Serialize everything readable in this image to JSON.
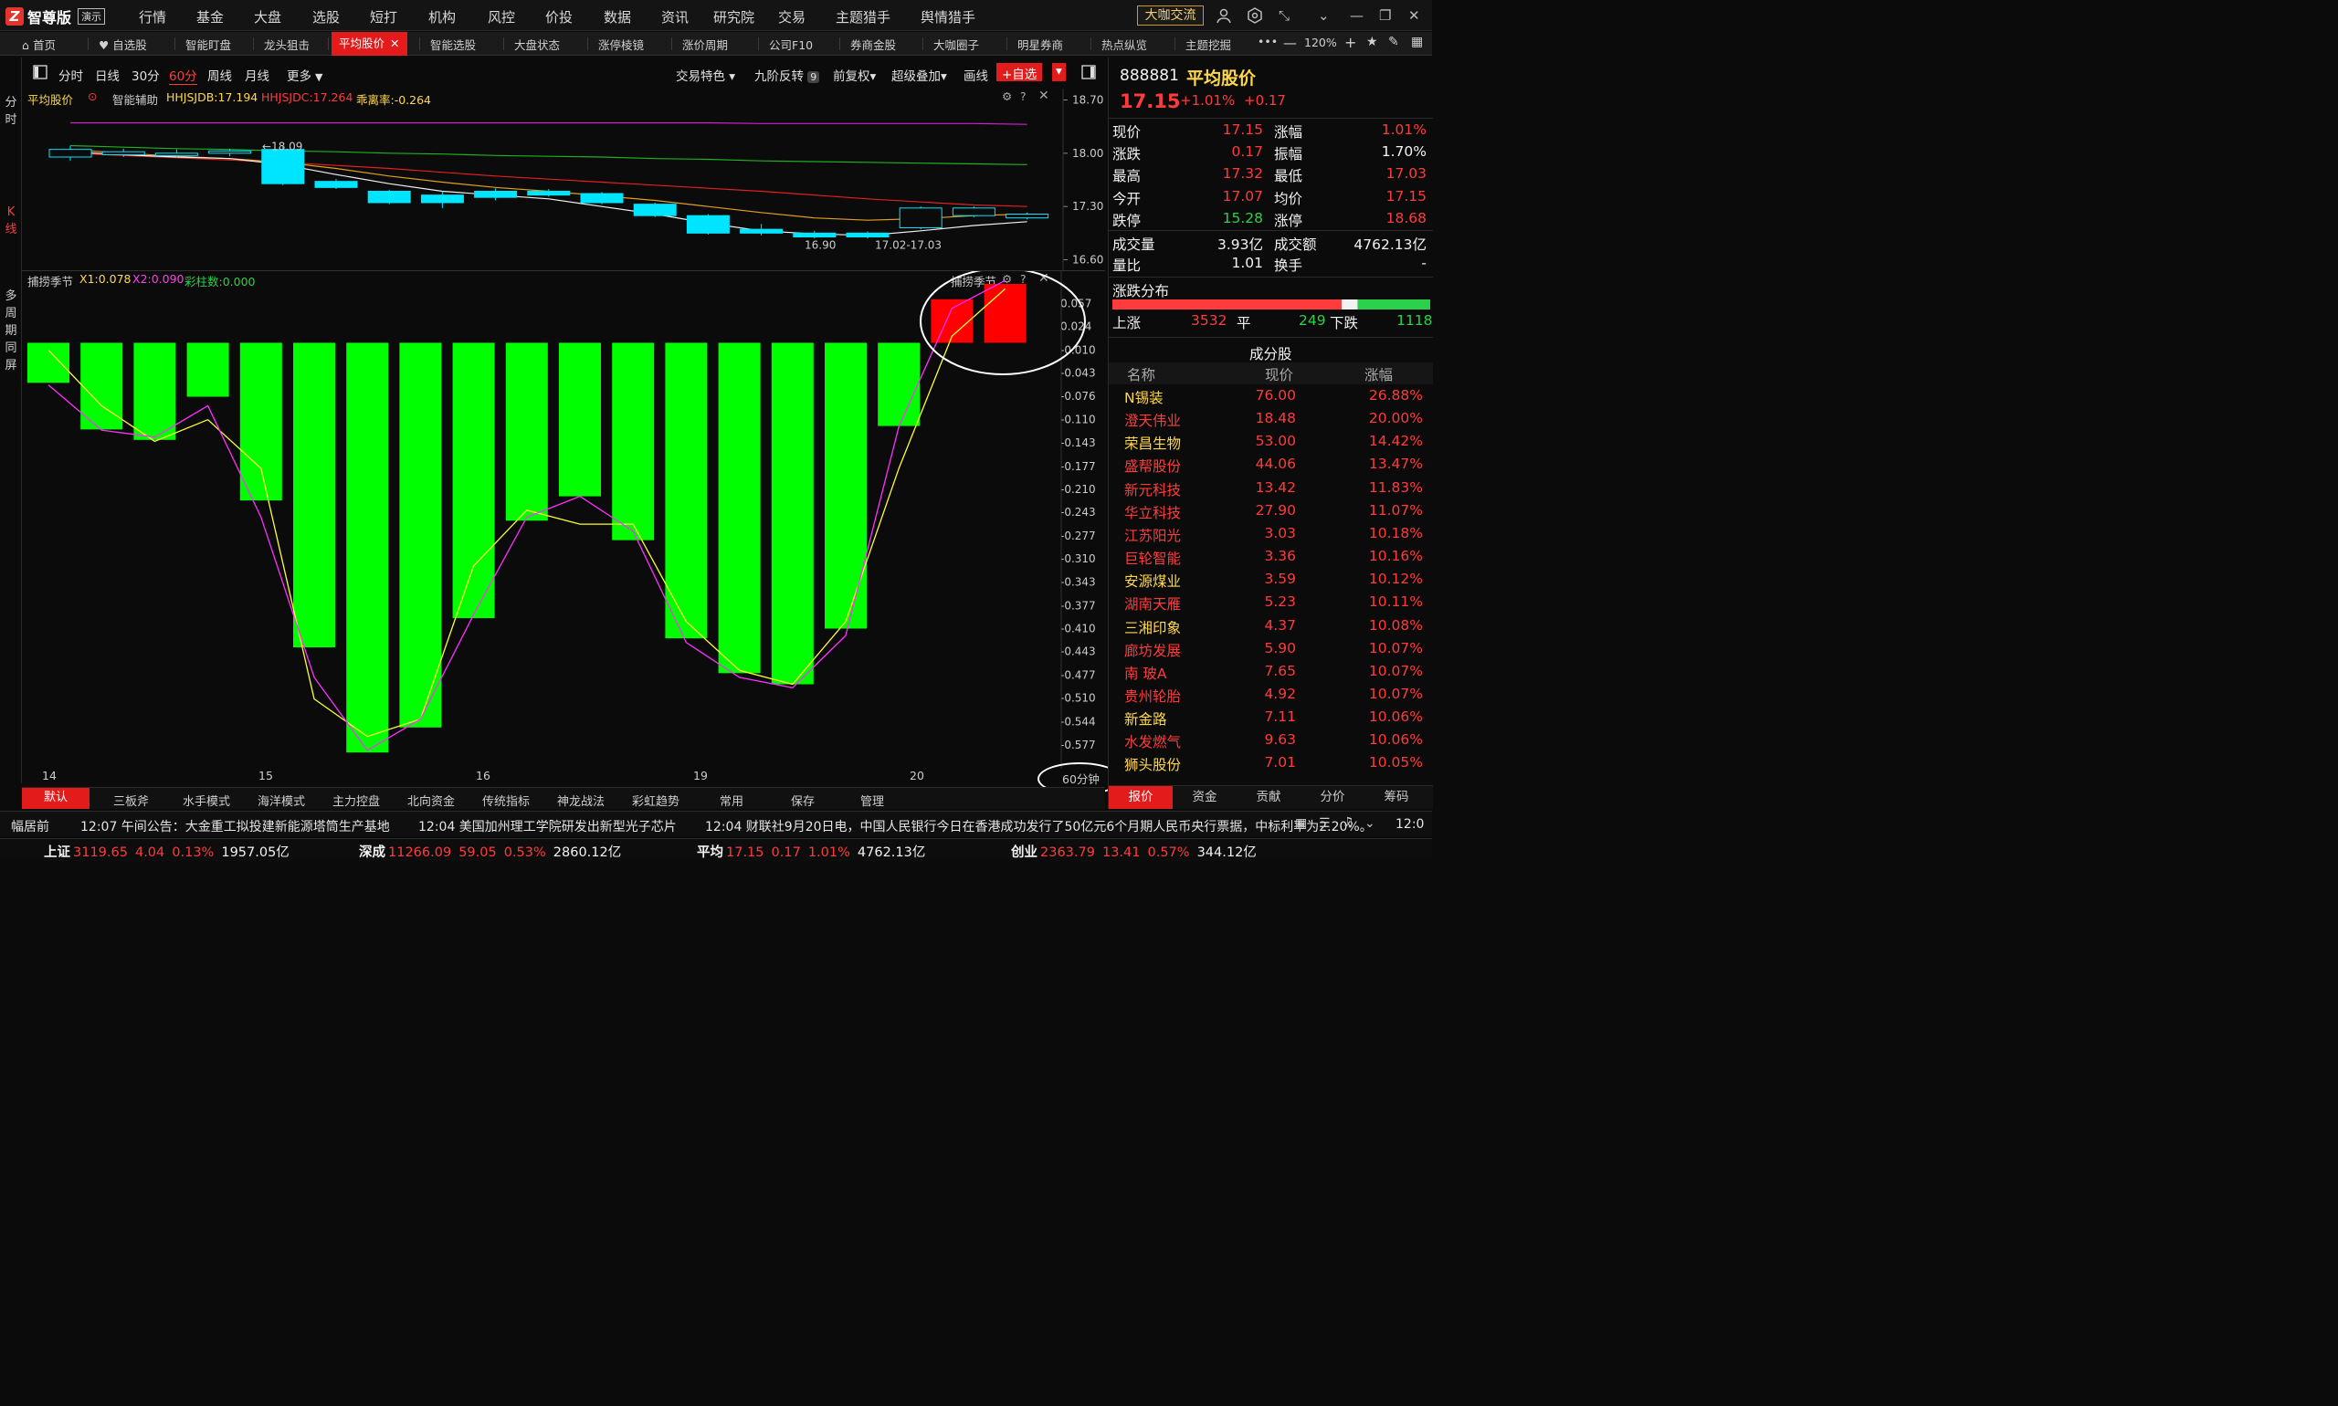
{
  "app": {
    "logo_text": "智尊版",
    "demo_badge": "演示"
  },
  "top_menu": [
    "行情",
    "基金",
    "大盘",
    "选股",
    "短打",
    "机构",
    "风控",
    "价投",
    "数据",
    "资讯",
    "研究院",
    "交易",
    "主题猎手",
    "舆情猎手"
  ],
  "daka_button": "大咖交流",
  "tabs": [
    "首页",
    "自选股",
    "智能盯盘",
    "龙头狙击",
    "平均股价",
    "智能选股",
    "大盘状态",
    "涨停棱镜",
    "涨价周期",
    "公司F10",
    "券商金股",
    "大咖圈子",
    "明星券商",
    "热点纵览",
    "主题挖掘"
  ],
  "active_tab_index": 4,
  "zoom_level": "120%",
  "left_strip": {
    "minute": "分时",
    "kline": "K线",
    "multi": "多周期同屏"
  },
  "period_buttons": [
    "分时",
    "日线",
    "30分",
    "60分",
    "周线",
    "月线",
    "更多"
  ],
  "active_period_index": 3,
  "chart_toolbar": {
    "trade_feature": "交易特色",
    "nine_reversal": "九阶反转",
    "nine_badge": "9",
    "adjust": "前复权",
    "overlay": "超级叠加",
    "draw": "画线",
    "add_watch": "+自选"
  },
  "kline_panel": {
    "indicator_name": "平均股价",
    "assist": "智能辅助",
    "hhjsjdb": "HHJSJDB:17.194",
    "hhjsjdc": "HHJSJDC:17.264",
    "deviation": "乖离率:-0.264",
    "y_ticks": [
      "18.70",
      "18.00",
      "17.30",
      "16.60"
    ],
    "high_marker": "←18.09",
    "low_marker": "16.90",
    "range_marker": "17.02-17.03"
  },
  "low_panel": {
    "indicator_name": "捕捞季节",
    "x1": "X1:0.078",
    "x2": "X2:0.090",
    "bars_count": "彩柱数:0.000",
    "corner_label": "捕捞季节",
    "y_ticks": [
      "0.057",
      "0.024",
      "-0.010",
      "-0.043",
      "-0.076",
      "-0.110",
      "-0.143",
      "-0.177",
      "-0.210",
      "-0.243",
      "-0.277",
      "-0.310",
      "-0.343",
      "-0.377",
      "-0.410",
      "-0.443",
      "-0.477",
      "-0.510",
      "-0.544",
      "-0.577"
    ]
  },
  "x_axis_labels": [
    "14",
    "15",
    "16",
    "19",
    "20"
  ],
  "period_badge": "60分钟",
  "bottom_tabs": [
    "默认",
    "三板斧",
    "水手模式",
    "海洋模式",
    "主力控盘",
    "北向资金",
    "传统指标",
    "神龙战法",
    "彩虹趋势",
    "常用",
    "保存",
    "管理"
  ],
  "chart_data": [
    {
      "type": "candlestick",
      "title": "平均股价",
      "ylim": [
        16.45,
        18.85
      ],
      "candles": [
        {
          "open": 17.95,
          "close": 18.05,
          "high": 18.1,
          "low": 17.9
        },
        {
          "open": 17.98,
          "close": 18.02,
          "high": 18.06,
          "low": 17.95
        },
        {
          "open": 17.97,
          "close": 18.0,
          "high": 18.05,
          "low": 17.94
        },
        {
          "open": 18.0,
          "close": 18.03,
          "high": 18.06,
          "low": 17.96
        },
        {
          "open": 18.05,
          "close": 17.6,
          "high": 18.09,
          "low": 17.58
        },
        {
          "open": 17.63,
          "close": 17.55,
          "high": 17.66,
          "low": 17.53
        },
        {
          "open": 17.5,
          "close": 17.35,
          "high": 17.52,
          "low": 17.33
        },
        {
          "open": 17.45,
          "close": 17.35,
          "high": 17.5,
          "low": 17.28
        },
        {
          "open": 17.5,
          "close": 17.42,
          "high": 17.54,
          "low": 17.38
        },
        {
          "open": 17.5,
          "close": 17.45,
          "high": 17.53,
          "low": 17.43
        },
        {
          "open": 17.47,
          "close": 17.35,
          "high": 17.49,
          "low": 17.33
        },
        {
          "open": 17.33,
          "close": 17.18,
          "high": 17.35,
          "low": 17.16
        },
        {
          "open": 17.18,
          "close": 16.95,
          "high": 17.2,
          "low": 16.93
        },
        {
          "open": 17.0,
          "close": 16.95,
          "high": 17.07,
          "low": 16.92
        },
        {
          "open": 16.95,
          "close": 16.9,
          "high": 16.98,
          "low": 16.88
        },
        {
          "open": 16.95,
          "close": 16.9,
          "high": 16.97,
          "low": 16.88
        },
        {
          "open": 17.02,
          "close": 17.28,
          "high": 17.3,
          "low": 17.0
        },
        {
          "open": 17.18,
          "close": 17.28,
          "high": 17.3,
          "low": 17.16
        },
        {
          "open": 17.15,
          "close": 17.2,
          "high": 17.22,
          "low": 17.13
        }
      ],
      "ma_lines": [
        {
          "color": "#d020d0",
          "values": [
            18.4,
            18.4,
            18.4,
            18.4,
            18.4,
            18.4,
            18.4,
            18.4,
            18.4,
            18.4,
            18.4,
            18.4,
            18.4,
            18.39,
            18.39,
            18.39,
            18.39,
            18.39,
            18.38
          ]
        },
        {
          "color": "#20b020",
          "values": [
            18.1,
            18.08,
            18.06,
            18.05,
            18.03,
            18.02,
            18.0,
            17.99,
            17.97,
            17.96,
            17.95,
            17.93,
            17.92,
            17.9,
            17.89,
            17.88,
            17.87,
            17.86,
            17.85
          ]
        },
        {
          "color": "#e02020",
          "values": [
            18.0,
            17.97,
            17.94,
            17.91,
            17.88,
            17.84,
            17.8,
            17.75,
            17.7,
            17.66,
            17.62,
            17.58,
            17.54,
            17.5,
            17.45,
            17.4,
            17.36,
            17.32,
            17.3
          ]
        },
        {
          "color": "#e0a020",
          "values": [
            18.05,
            18.0,
            17.96,
            17.93,
            17.88,
            17.8,
            17.7,
            17.62,
            17.55,
            17.5,
            17.44,
            17.38,
            17.3,
            17.22,
            17.15,
            17.12,
            17.14,
            17.18,
            17.2
          ]
        },
        {
          "color": "#f0f0f0",
          "values": [
            18.02,
            17.98,
            17.95,
            17.93,
            17.85,
            17.72,
            17.6,
            17.5,
            17.45,
            17.4,
            17.3,
            17.2,
            17.08,
            16.98,
            16.94,
            16.92,
            16.98,
            17.05,
            17.1
          ]
        }
      ]
    },
    {
      "type": "bar",
      "title": "捕捞季节",
      "categories": [
        "1",
        "2",
        "3",
        "4",
        "5",
        "6",
        "7",
        "8",
        "9",
        "10",
        "11",
        "12",
        "13",
        "14",
        "15",
        "16",
        "17",
        "18",
        "19"
      ],
      "ylim": [
        -0.61,
        0.085
      ],
      "values": [
        -0.057,
        -0.124,
        -0.139,
        -0.077,
        -0.226,
        -0.437,
        -0.588,
        -0.552,
        -0.395,
        -0.255,
        -0.22,
        -0.283,
        -0.424,
        -0.474,
        -0.49,
        -0.41,
        -0.119,
        0.063,
        0.085
      ],
      "series": [
        {
          "name": "X1",
          "color": "#ffff30",
          "values": [
            -0.01,
            -0.09,
            -0.141,
            -0.11,
            -0.18,
            -0.511,
            -0.565,
            -0.54,
            -0.32,
            -0.24,
            -0.26,
            -0.26,
            -0.4,
            -0.47,
            -0.49,
            -0.4,
            -0.18,
            0.01,
            0.078
          ]
        },
        {
          "name": "X2",
          "color": "#ff30ff",
          "values": [
            -0.06,
            -0.125,
            -0.135,
            -0.09,
            -0.25,
            -0.48,
            -0.585,
            -0.54,
            -0.39,
            -0.25,
            -0.22,
            -0.27,
            -0.43,
            -0.48,
            -0.495,
            -0.42,
            -0.12,
            0.05,
            0.09
          ]
        }
      ]
    }
  ],
  "stock": {
    "code": "888881",
    "name": "平均股价",
    "price": "17.15",
    "change_pct": "+1.01%",
    "change": "+0.17",
    "quote_rows": [
      {
        "l1": "现价",
        "v1": "17.15",
        "c1": "red",
        "l2": "涨幅",
        "v2": "1.01%",
        "c2": "red"
      },
      {
        "l1": "涨跌",
        "v1": "0.17",
        "c1": "red",
        "l2": "振幅",
        "v2": "1.70%",
        "c2": "white"
      },
      {
        "l1": "最高",
        "v1": "17.32",
        "c1": "red",
        "l2": "最低",
        "v2": "17.03",
        "c2": "red"
      },
      {
        "l1": "今开",
        "v1": "17.07",
        "c1": "red",
        "l2": "均价",
        "v2": "17.15",
        "c2": "red"
      },
      {
        "l1": "跌停",
        "v1": "15.28",
        "c1": "green",
        "l2": "涨停",
        "v2": "18.68",
        "c2": "red"
      }
    ],
    "volume_rows": [
      {
        "l1": "成交量",
        "v1": "3.93亿",
        "l2": "成交额",
        "v2": "4762.13亿"
      },
      {
        "l1": "量比",
        "v1": "1.01",
        "l2": "换手",
        "v2": "-"
      }
    ],
    "distribution_title": "涨跌分布",
    "distribution": {
      "up_label": "上涨",
      "up": "3532",
      "flat_label": "平",
      "flat": "249",
      "down_label": "下跌",
      "down": "1118",
      "up_count": 3532,
      "flat_count": 249,
      "down_count": 1118
    },
    "components_title": "成分股",
    "component_headers": [
      "名称",
      "现价",
      "涨幅"
    ],
    "components": [
      {
        "name": "N锡装",
        "price": "76.00",
        "pct": "26.88%",
        "color": "#ffd84a"
      },
      {
        "name": "澄天伟业",
        "price": "18.48",
        "pct": "20.00%",
        "color": "#ff3b3b"
      },
      {
        "name": "荣昌生物",
        "price": "53.00",
        "pct": "14.42%",
        "color": "#ffd84a"
      },
      {
        "name": "盛帮股份",
        "price": "44.06",
        "pct": "13.47%",
        "color": "#ff3b3b"
      },
      {
        "name": "新元科技",
        "price": "13.42",
        "pct": "11.83%",
        "color": "#ff3b3b"
      },
      {
        "name": "华立科技",
        "price": "27.90",
        "pct": "11.07%",
        "color": "#ff3b3b"
      },
      {
        "name": "江苏阳光",
        "price": "3.03",
        "pct": "10.18%",
        "color": "#ff3b3b"
      },
      {
        "name": "巨轮智能",
        "price": "3.36",
        "pct": "10.16%",
        "color": "#ff3b3b"
      },
      {
        "name": "安源煤业",
        "price": "3.59",
        "pct": "10.12%",
        "color": "#ffd84a"
      },
      {
        "name": "湖南天雁",
        "price": "5.23",
        "pct": "10.11%",
        "color": "#ff3b3b"
      },
      {
        "name": "三湘印象",
        "price": "4.37",
        "pct": "10.08%",
        "color": "#ffd84a"
      },
      {
        "name": "廊坊发展",
        "price": "5.90",
        "pct": "10.07%",
        "color": "#ff3b3b"
      },
      {
        "name": "南 玻A",
        "price": "7.65",
        "pct": "10.07%",
        "color": "#ff3b3b"
      },
      {
        "name": "贵州轮胎",
        "price": "4.92",
        "pct": "10.07%",
        "color": "#ff3b3b"
      },
      {
        "name": "新金路",
        "price": "7.11",
        "pct": "10.06%",
        "color": "#ffd84a"
      },
      {
        "name": "水发燃气",
        "price": "9.63",
        "pct": "10.06%",
        "color": "#ff3b3b"
      },
      {
        "name": "狮头股份",
        "price": "7.01",
        "pct": "10.05%",
        "color": "#ffd84a"
      }
    ],
    "right_tabs": [
      "报价",
      "资金",
      "贡献",
      "分价",
      "筹码"
    ]
  },
  "ticker": {
    "label": "幅居前",
    "news": [
      "12:07 午间公告：大金重工拟投建新能源塔筒生产基地",
      "12:04 美国加州理工学院研发出新型光子芯片",
      "12:04 财联社9月20日电，中国人民银行今日在香港成功发行了50亿元6个月期人民币央行票据，中标利率为2.20%。"
    ],
    "time": "12:0"
  },
  "status": [
    {
      "name": "上证",
      "value": "3119.65",
      "chg": "4.04",
      "pct": "0.13%",
      "amt": "1957.05亿"
    },
    {
      "name": "深成",
      "value": "11266.09",
      "chg": "59.05",
      "pct": "0.53%",
      "amt": "2860.12亿"
    },
    {
      "name": "平均",
      "value": "17.15",
      "chg": "0.17",
      "pct": "1.01%",
      "amt": "4762.13亿"
    },
    {
      "name": "创业",
      "value": "2363.79",
      "chg": "13.41",
      "pct": "0.57%",
      "amt": "344.12亿"
    }
  ],
  "colors": {
    "up": "#ff3b3b",
    "down": "#2bd14a",
    "accent": "#e31b1b",
    "cyan": "#00e5ff",
    "bar_green": "#00ff00",
    "bar_red": "#ff0000"
  }
}
